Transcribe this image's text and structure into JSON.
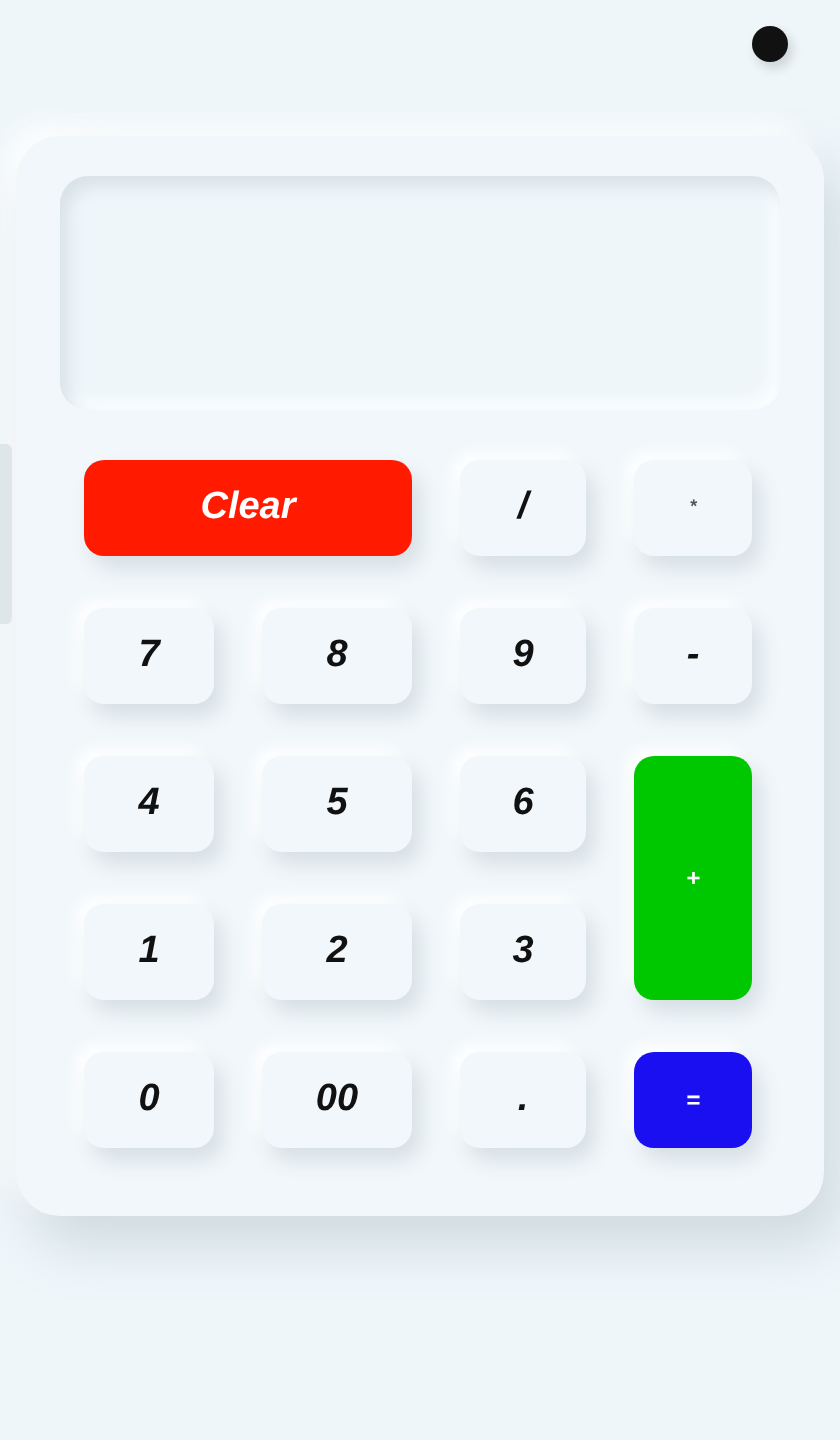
{
  "keys": [
    {
      "label": "Clear",
      "kind": "clear"
    },
    {
      "label": "/",
      "kind": "operator"
    },
    {
      "label": "*",
      "kind": "faint"
    },
    {
      "label": "7",
      "kind": "number"
    },
    {
      "label": "8",
      "kind": "number"
    },
    {
      "label": "9",
      "kind": "number"
    },
    {
      "label": "-",
      "kind": "operator"
    },
    {
      "label": "4",
      "kind": "number"
    },
    {
      "label": "5",
      "kind": "number"
    },
    {
      "label": "6",
      "kind": "number"
    },
    {
      "label": "+",
      "kind": "add"
    },
    {
      "label": "1",
      "kind": "number"
    },
    {
      "label": "2",
      "kind": "number"
    },
    {
      "label": "3",
      "kind": "number"
    },
    {
      "label": "0",
      "kind": "number"
    },
    {
      "label": "00",
      "kind": "number"
    },
    {
      "label": ".",
      "kind": "number"
    },
    {
      "label": "=",
      "kind": "equals"
    }
  ]
}
